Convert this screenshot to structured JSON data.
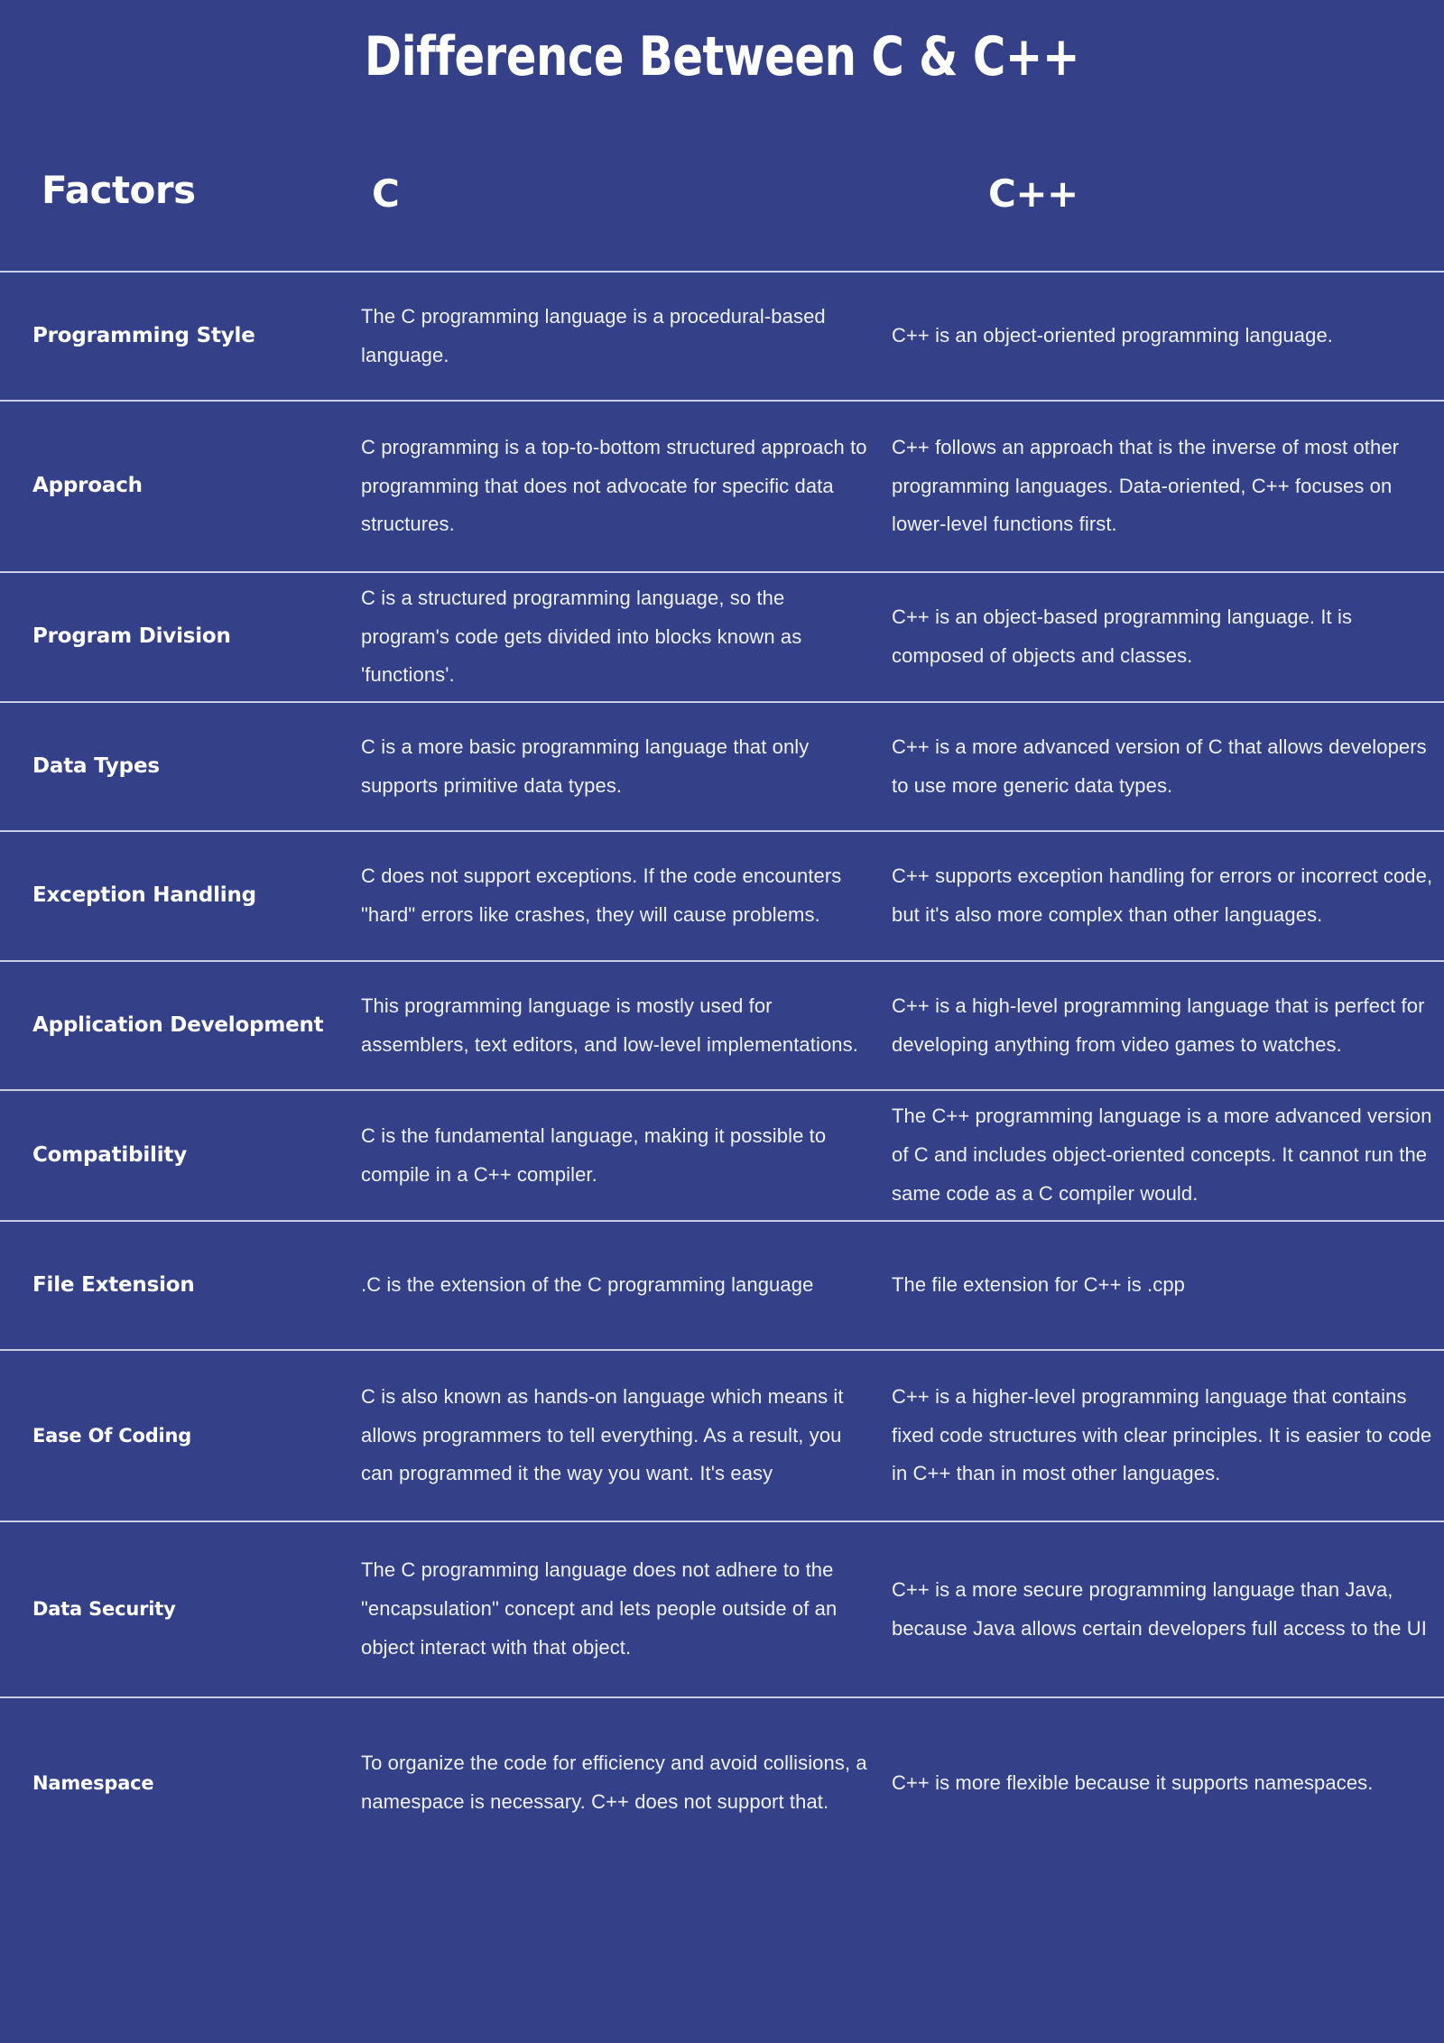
{
  "title": "Difference Between C & C++",
  "theme": {
    "background": "#344088",
    "text": "#ffffff",
    "body_text": "#eef1f8",
    "divider": "#c9cfe4"
  },
  "headers": {
    "factors": "Factors",
    "c": "C",
    "cpp": "C++"
  },
  "rows": [
    {
      "factor": "Programming Style",
      "c": "The C programming language is a procedural-based language.",
      "cpp": "C++ is an object-oriented programming language."
    },
    {
      "factor": "Approach",
      "c": "C programming is a top-to-bottom structured approach to programming that does not advocate for specific data structures.",
      "cpp": "C++ follows an approach that is the inverse of most other programming languages. Data-oriented, C++ focuses on lower-level functions first."
    },
    {
      "factor": "Program Division",
      "c": "C is a structured programming language, so the program's code gets divided into blocks known as 'functions'.",
      "cpp": "C++ is an object-based programming language. It is composed of objects and classes."
    },
    {
      "factor": "Data Types",
      "c": "C is a more basic programming language that only supports primitive data types.",
      "cpp": "C++ is a more advanced version of C that allows developers to use more generic data types."
    },
    {
      "factor": "Exception Handling",
      "c": "C does not support exceptions. If the code encounters \"hard\" errors like crashes, they will cause problems.",
      "cpp": "C++ supports exception handling for errors or incorrect code, but it's also more complex than other languages."
    },
    {
      "factor": "Application Development",
      "c": "This programming language is mostly used for assemblers, text editors, and low-level implementations.",
      "cpp": "C++ is a high-level programming language that is perfect for developing anything from video games to watches."
    },
    {
      "factor": "Compatibility",
      "c": "C is the fundamental language, making it possible to compile in a C++ compiler.",
      "cpp": "The C++ programming language is a more advanced version of C and includes object-oriented concepts. It cannot run the same code as a C compiler would."
    },
    {
      "factor": "File Extension",
      "c": ".C is the extension of the C programming language",
      "cpp": "The file extension for C++ is .cpp"
    },
    {
      "factor": "Ease Of Coding",
      "c": "C is also known as hands-on language which means it allows programmers to tell everything. As a result, you can programmed it the way you want. It's easy",
      "cpp": "C++ is a higher-level programming language that contains fixed code structures with clear principles. It is easier to code in C++ than in most other languages."
    },
    {
      "factor": "Data Security",
      "c": "The C programming language does not adhere to the \"encapsulation\" concept and lets people outside of an object interact with that object.",
      "cpp": "C++ is a more secure programming language than Java, because Java allows certain developers full access to the UI"
    },
    {
      "factor": "Namespace",
      "c": "To organize the code for efficiency and avoid collisions, a namespace is necessary. C++ does not support that.",
      "cpp": "C++ is more flexible because it supports namespaces."
    }
  ]
}
